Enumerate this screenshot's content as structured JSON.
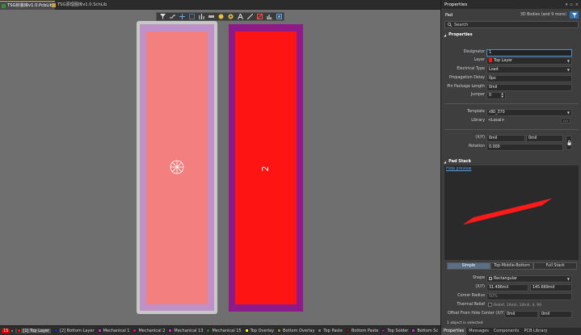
{
  "tabs": [
    {
      "label": "TSG封装库v1.0.PcbLib",
      "active": true
    },
    {
      "label": "TSG原理图库v1.0.SchLib",
      "active": false
    }
  ],
  "toolbar": {
    "items": [
      "filter-icon",
      "route-icon",
      "add-icon",
      "select-rect-icon",
      "align-icon",
      "component-icon",
      "pad-icon",
      "via-icon",
      "text-icon",
      "line-icon",
      "keepout-icon",
      "chart-icon",
      "snap-icon"
    ]
  },
  "canvas": {
    "pad2_designator": "2",
    "colors": {
      "top_layer": "#ff1414",
      "solder_mask": "#8e1a8a",
      "selection": "#f47f7f"
    }
  },
  "layers": {
    "count": "15",
    "items": [
      {
        "label": "[1] Top Layer",
        "color": "#ff1414",
        "active": true
      },
      {
        "label": "[2] Bottom Layer",
        "color": "#2a2ab8"
      },
      {
        "label": "Mechanical 1",
        "color": "#cc33cc"
      },
      {
        "label": "Mechanical 2",
        "color": "#c01c6c"
      },
      {
        "label": "Mechanical 13",
        "color": "#cc33cc"
      },
      {
        "label": "Mechanical 15",
        "color": "#2a7a3a"
      },
      {
        "label": "Top Overlay",
        "color": "#ffff00"
      },
      {
        "label": "Bottom Overlay",
        "color": "#8a8a3a"
      },
      {
        "label": "Top Paste",
        "color": "#808080"
      },
      {
        "label": "Bottom Paste",
        "color": "#7a1010"
      },
      {
        "label": "Top Solder",
        "color": "#8e1a8a"
      },
      {
        "label": "Bottom Sc",
        "color": "#cc33cc"
      }
    ]
  },
  "panel": {
    "title": "Properties",
    "object_type": "Pad",
    "filter_text": "3D Bodies (and 9 more)",
    "search_placeholder": "Search",
    "sections": {
      "properties": "Properties",
      "pad_stack": "Pad Stack"
    },
    "fields": {
      "designator_label": "Designator",
      "designator_value": "1",
      "layer_label": "Layer",
      "layer_value": "Top Layer",
      "electrical_type_label": "Electrical Type",
      "electrical_type_value": "Load",
      "prop_delay_label": "Propagation Delay",
      "prop_delay_value": "0ps",
      "pin_pkg_len_label": "Pin Package Length",
      "pin_pkg_len_value": "0mil",
      "jumper_label": "Jumper",
      "jumper_value": "0",
      "template_label": "Template",
      "template_value": "r80_370",
      "library_label": "Library",
      "library_value": "<Local>",
      "xy_label": "(X/Y)",
      "x_value": "0mil",
      "y_value": "0mil",
      "rotation_label": "Rotation",
      "rotation_value": "0.000"
    },
    "pad_stack": {
      "hide_preview": "Hide preview",
      "tabs": [
        "Simple",
        "Top-Middle-Bottom",
        "Full Stack"
      ],
      "active_tab": "Simple",
      "shape_label": "Shape",
      "shape_value": "Rectangular",
      "size_label": "(X/Y)",
      "size_x": "31.496mil",
      "size_y": "145.669mil",
      "corner_radius_label": "Corner Radius",
      "corner_radius_value": "50%",
      "thermal_relief_label": "Thermal Relief",
      "thermal_relief_value": "Relief, 10mil, 10mil, 4, 90",
      "offset_label": "Offset From Hole Center (X/Y)",
      "offset_x": "0mil",
      "offset_y": "0mil"
    },
    "status": "1 object is selected",
    "bottom_tabs": [
      "Properties",
      "Messages",
      "Components",
      "PCB Library"
    ]
  }
}
